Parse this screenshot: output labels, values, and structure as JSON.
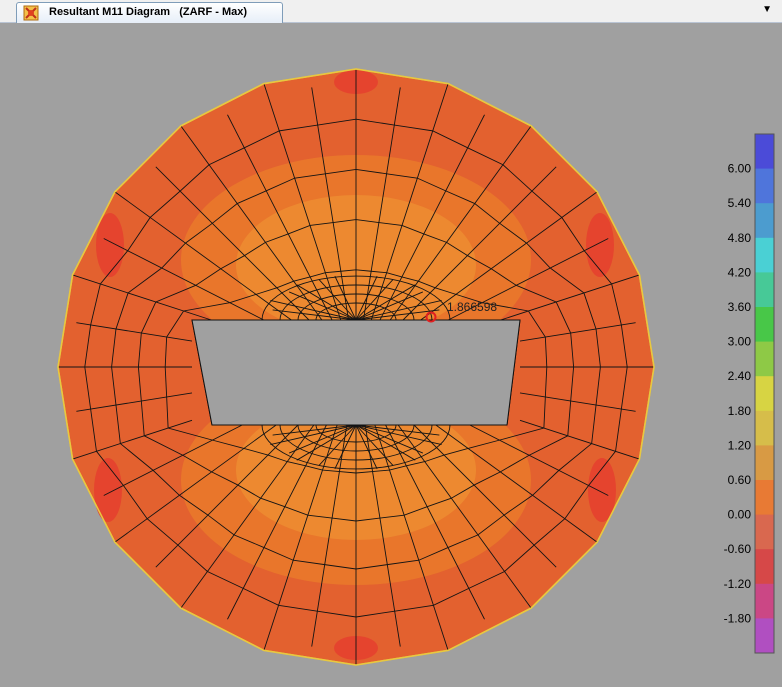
{
  "tab": {
    "title": "Resultant M11 Diagram   (ZARF - Max)",
    "icon": "diagram-icon"
  },
  "dropdown_icon": "chevron-down-icon",
  "result": {
    "marker_value": "1.866598"
  },
  "legend": {
    "labels": [
      "6.00",
      "5.40",
      "4.80",
      "4.20",
      "3.60",
      "3.00",
      "2.40",
      "1.80",
      "1.20",
      "0.60",
      "0.00",
      "-0.60",
      "-1.20",
      "-1.80"
    ],
    "colors": [
      "#4b4bd8",
      "#4f75db",
      "#4c9ccf",
      "#4ad0d4",
      "#47c997",
      "#48c748",
      "#8ec946",
      "#d7d443",
      "#d6bd4a",
      "#d89a44",
      "#e87a34",
      "#d9684f",
      "#d64848",
      "#cb4785",
      "#b04fc1"
    ]
  },
  "colors": {
    "background": "#a0a0a0",
    "shell_main": "#e3612f",
    "shell_light": "#e9792b",
    "shell_lighter": "#ee9033",
    "shell_red": "#e5402e",
    "mesh_lines": "#141414"
  }
}
